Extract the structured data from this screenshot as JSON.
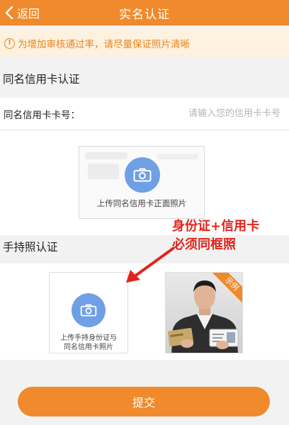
{
  "header": {
    "back_label": "返回",
    "title": "实名认证"
  },
  "notice": {
    "text": "为增加审核通过率，请尽量保证照片清晰"
  },
  "credit_card": {
    "section_title": "同名信用卡认证",
    "field_label": "同名信用卡卡号：",
    "field_placeholder": "请输入您的信用卡卡号",
    "field_value": "",
    "upload_label": "上传同名信用卡正面照片"
  },
  "hand_held": {
    "section_title": "手持照认证",
    "upload_label_line1": "上传手持身份证与",
    "upload_label_line2": "同名信用卡照片",
    "sample_badge": "示例"
  },
  "annotation": {
    "line1": "身份证+信用卡",
    "line2": "必须同框照"
  },
  "submit_label": "提交",
  "colors": {
    "accent": "#f08a2c",
    "notice_bg": "#fdf1df",
    "camera_blue": "#6fa0e6",
    "annotation_red": "#e2231a"
  },
  "icons": {
    "back": "chevron-left-icon",
    "info": "info-icon",
    "camera": "camera-icon",
    "arrow": "arrow-icon"
  }
}
